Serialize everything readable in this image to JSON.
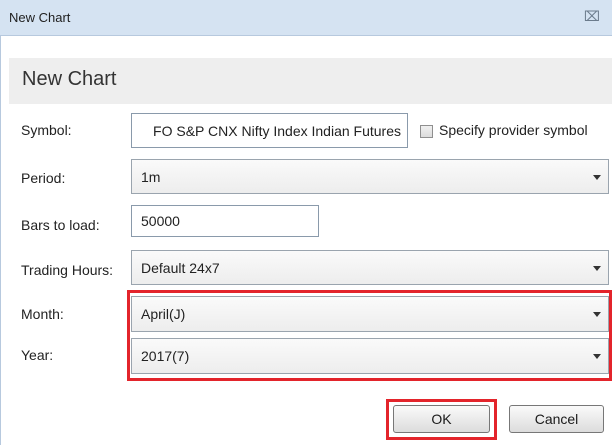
{
  "window": {
    "title": "New Chart",
    "close_glyph": "⌧",
    "close_icon": "close-icon"
  },
  "header": {
    "title": "New Chart"
  },
  "form": {
    "symbol": {
      "label": "Symbol:",
      "value": "FO S&P CNX Nifty Index Indian Futures"
    },
    "specify_provider": {
      "label": "Specify provider symbol",
      "checked": false
    },
    "period": {
      "label": "Period:",
      "value": "1m"
    },
    "bars_to_load": {
      "label": "Bars to load:",
      "value": "50000"
    },
    "trading_hours": {
      "label": "Trading Hours:",
      "value": "Default 24x7"
    },
    "month": {
      "label": "Month:",
      "value": "April(J)"
    },
    "year": {
      "label": "Year:",
      "value": "2017(7)"
    }
  },
  "buttons": {
    "ok": "OK",
    "cancel": "Cancel"
  },
  "colors": {
    "highlight": "#e3242b",
    "titlebar": "#d5e3f2"
  }
}
